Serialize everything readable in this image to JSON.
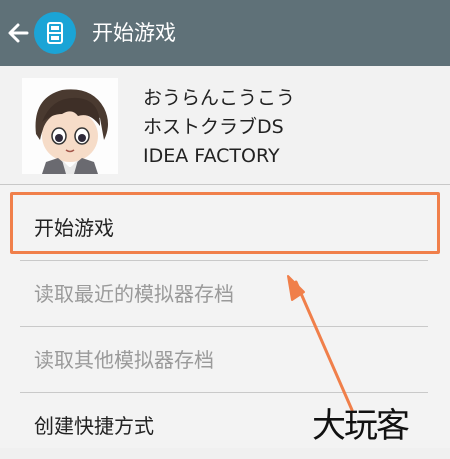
{
  "toolbar": {
    "title": "开始游戏",
    "back_icon": "arrow-left-icon",
    "app_icon": "ds-console-icon",
    "color": "#5f7178",
    "icon_color": "#1ba4d6"
  },
  "game": {
    "title_jp": "おうらんこうこう",
    "title_sub": "ホストクラブDS",
    "publisher": "IDEA FACTORY",
    "cover_icon": "anime-character-portrait"
  },
  "menu": {
    "items": [
      {
        "label": "开始游戏",
        "enabled": true
      },
      {
        "label": "读取最近的模拟器存档",
        "enabled": false
      },
      {
        "label": "读取其他模拟器存档",
        "enabled": false
      },
      {
        "label": "创建快捷方式",
        "enabled": true
      }
    ]
  },
  "annotation": {
    "highlight_color": "#f07f4a"
  },
  "watermark": {
    "text": "大玩客"
  }
}
